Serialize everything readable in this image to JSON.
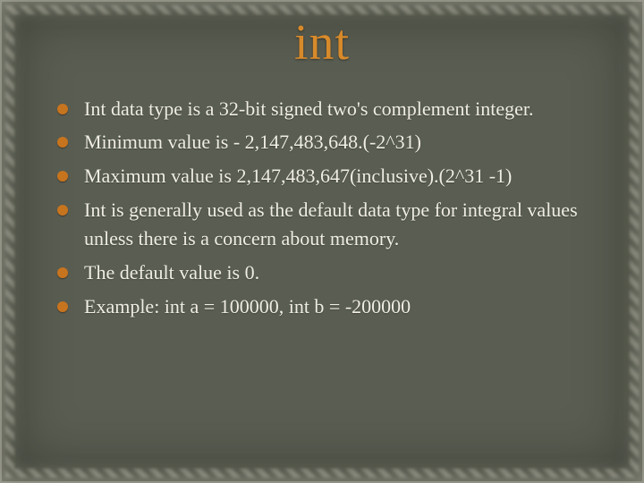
{
  "title": "int",
  "bullets": [
    "Int data type is a 32-bit signed two's complement integer.",
    "Minimum value is - 2,147,483,648.(-2^31)",
    "Maximum value is 2,147,483,647(inclusive).(2^31 -1)",
    "Int is generally used as the default data type for integral values unless there is a concern about memory.",
    "The default value is 0.",
    "Example: int a = 100000, int b = -200000"
  ]
}
